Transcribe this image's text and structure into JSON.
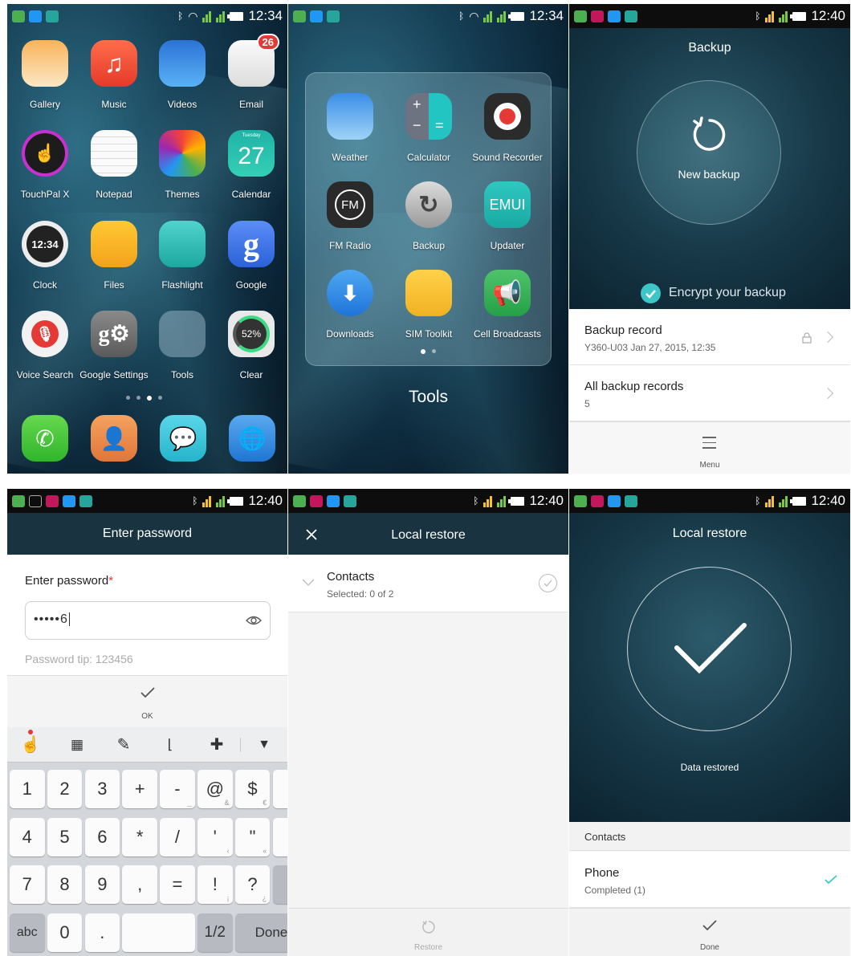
{
  "screens": {
    "home": {
      "status": {
        "time": "12:34"
      },
      "apps": [
        {
          "label": "Gallery",
          "icon": "gallery-icon"
        },
        {
          "label": "Music",
          "icon": "music-icon"
        },
        {
          "label": "Videos",
          "icon": "videos-icon"
        },
        {
          "label": "Email",
          "icon": "email-icon",
          "badge": "26"
        },
        {
          "label": "TouchPal X",
          "icon": "touchpal-icon"
        },
        {
          "label": "Notepad",
          "icon": "notepad-icon"
        },
        {
          "label": "Themes",
          "icon": "themes-icon"
        },
        {
          "label": "Calendar",
          "icon": "calendar-icon",
          "day": "27",
          "weekday": "Tuesday"
        },
        {
          "label": "Clock",
          "icon": "clock-icon",
          "time": "12:34"
        },
        {
          "label": "Files",
          "icon": "files-icon"
        },
        {
          "label": "Flashlight",
          "icon": "flashlight-icon"
        },
        {
          "label": "Google",
          "icon": "google-icon"
        },
        {
          "label": "Voice Search",
          "icon": "microphone-icon"
        },
        {
          "label": "Google Settings",
          "icon": "google-settings-icon"
        },
        {
          "label": "Tools",
          "icon": "folder-icon"
        },
        {
          "label": "Clear",
          "icon": "clear-icon",
          "percent": "52%"
        }
      ],
      "dock": [
        "phone-icon",
        "contacts-icon",
        "messaging-icon",
        "browser-icon"
      ]
    },
    "tools": {
      "status": {
        "time": "12:34"
      },
      "folder_title": "Tools",
      "apps": [
        {
          "label": "Weather",
          "icon": "weather-icon"
        },
        {
          "label": "Calculator",
          "icon": "calculator-icon"
        },
        {
          "label": "Sound Recorder",
          "icon": "sound-recorder-icon"
        },
        {
          "label": "FM Radio",
          "icon": "fm-radio-icon",
          "text": "FM"
        },
        {
          "label": "Backup",
          "icon": "backup-icon"
        },
        {
          "label": "Updater",
          "icon": "updater-icon",
          "text": "EMUI"
        },
        {
          "label": "Downloads",
          "icon": "downloads-icon"
        },
        {
          "label": "SIM Toolkit",
          "icon": "sim-icon"
        },
        {
          "label": "Cell Broadcasts",
          "icon": "megaphone-icon"
        }
      ]
    },
    "backup": {
      "status": {
        "time": "12:40"
      },
      "title": "Backup",
      "new_backup": "New backup",
      "encrypt": "Encrypt your backup",
      "record_title": "Backup record",
      "record_sub": "Y360-U03  Jan 27, 2015, 12:35",
      "all_title": "All backup records",
      "all_count": "5",
      "menu": "Menu"
    },
    "password": {
      "status": {
        "time": "12:40"
      },
      "title": "Enter password",
      "label": "Enter password",
      "required": "*",
      "value_dots": "•••••",
      "value_last": "6",
      "tip": "Password tip: 123456",
      "ok": "OK",
      "keyboard": {
        "rows": [
          [
            "1",
            "2",
            "3",
            "+",
            "-",
            "@",
            "$",
            "(",
            ")"
          ],
          [
            "4",
            "5",
            "6",
            "*",
            "/",
            "'",
            "\"",
            ":",
            "#"
          ],
          [
            "7",
            "8",
            "9",
            ",",
            "=",
            "!",
            "?"
          ]
        ],
        "sub": {
          "@": "&",
          "$": "€",
          "(": "<",
          ")": ">",
          "#": "%",
          "'": "‹",
          "\"": "«",
          ":": ";",
          "!": "¡",
          "?": "¿",
          "-": "_"
        },
        "abc": "abc",
        "zero": "0",
        "dot": ".",
        "page": "1/2",
        "done": "Done"
      }
    },
    "restore": {
      "status": {
        "time": "12:40"
      },
      "title": "Local restore",
      "item": "Contacts",
      "item_sub": "Selected: 0 of 2",
      "action": "Restore"
    },
    "restored": {
      "status": {
        "time": "12:40"
      },
      "title": "Local restore",
      "message": "Data restored",
      "section": "Contacts",
      "item": "Phone",
      "item_sub": "Completed (1)",
      "done": "Done"
    }
  }
}
